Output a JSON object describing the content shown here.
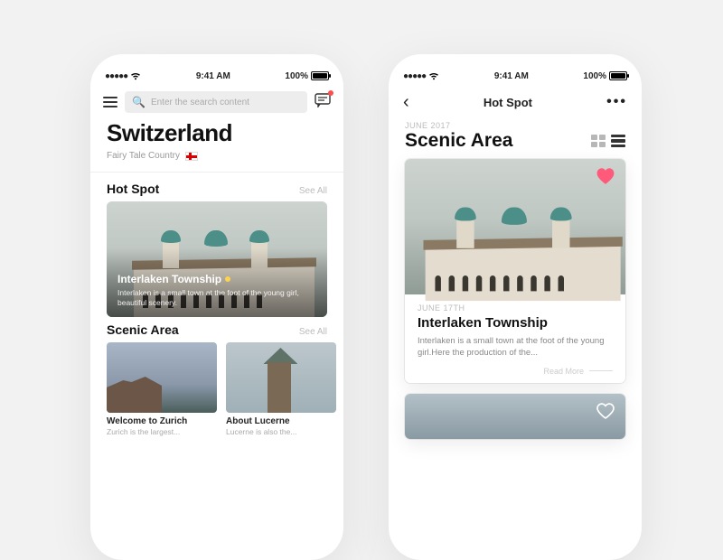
{
  "status": {
    "time": "9:41 AM",
    "battery": "100%"
  },
  "left": {
    "search_placeholder": "Enter the search content",
    "title": "Switzerland",
    "subtitle": "Fairy Tale Country",
    "sections": {
      "hotspot": {
        "title": "Hot Spot",
        "see_all": "See All"
      },
      "scenic": {
        "title": "Scenic Area",
        "see_all": "See All"
      }
    },
    "hero": {
      "title": "Interlaken Township",
      "desc": "Interlaken is a small town at the foot of the young girl, beautiful scenery."
    },
    "scenic_cards": [
      {
        "title": "Welcome to Zurich",
        "desc": "Zurich is the largest..."
      },
      {
        "title": "About Lucerne",
        "desc": "Lucerne is also the..."
      }
    ]
  },
  "right": {
    "nav_title": "Hot Spot",
    "month": "JUNE 2017",
    "page_title": "Scenic Area",
    "card": {
      "date": "JUNE 17TH",
      "title": "Interlaken Township",
      "desc": "Interlaken is a small town at the foot of the young girl.Here the production of the...",
      "read_more": "Read More"
    }
  }
}
